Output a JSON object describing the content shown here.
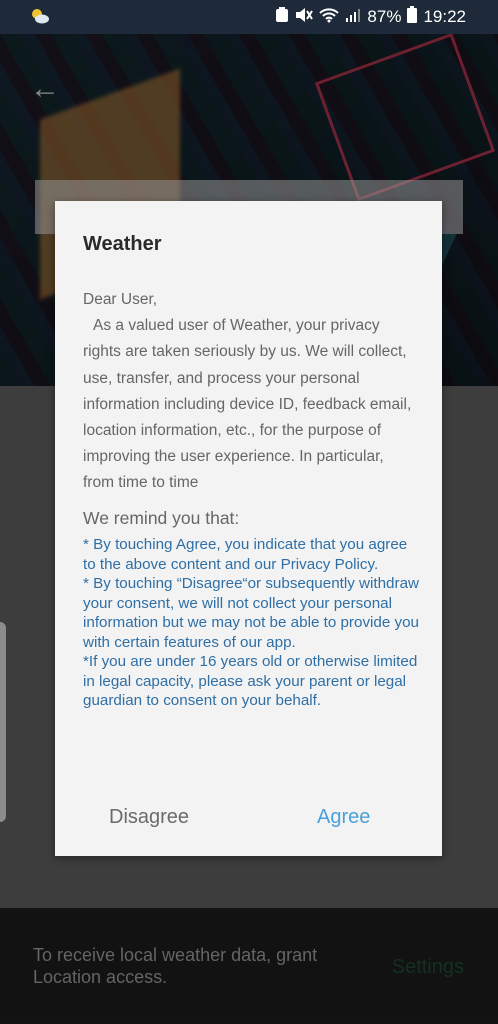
{
  "status_bar": {
    "battery": "87%",
    "time": "19:22"
  },
  "snackbar": {
    "message": "To receive local weather data, grant Location access.",
    "action": "Settings"
  },
  "dialog": {
    "title": "Weather",
    "greeting": "Dear User,",
    "body": "As a valued user of Weather, your privacy rights are taken seriously by us. We will collect, use, transfer, and process your personal information including device ID, feedback email, location information, etc., for the purpose of improving the user experience. In particular, from time to time",
    "remind_heading": "We remind you that:",
    "points": [
      "* By touching Agree, you indicate that you agree to the above content and our Privacy Policy.",
      "* By touching “Disagree“or subsequently withdraw your consent, we will not collect your personal information but  we may not be able to provide you with certain features of our app.",
      "*If you are under 16 years old or otherwise limited in legal capacity, please ask your parent or legal guardian to consent on your behalf."
    ],
    "disagree_label": "Disagree",
    "agree_label": "Agree"
  }
}
